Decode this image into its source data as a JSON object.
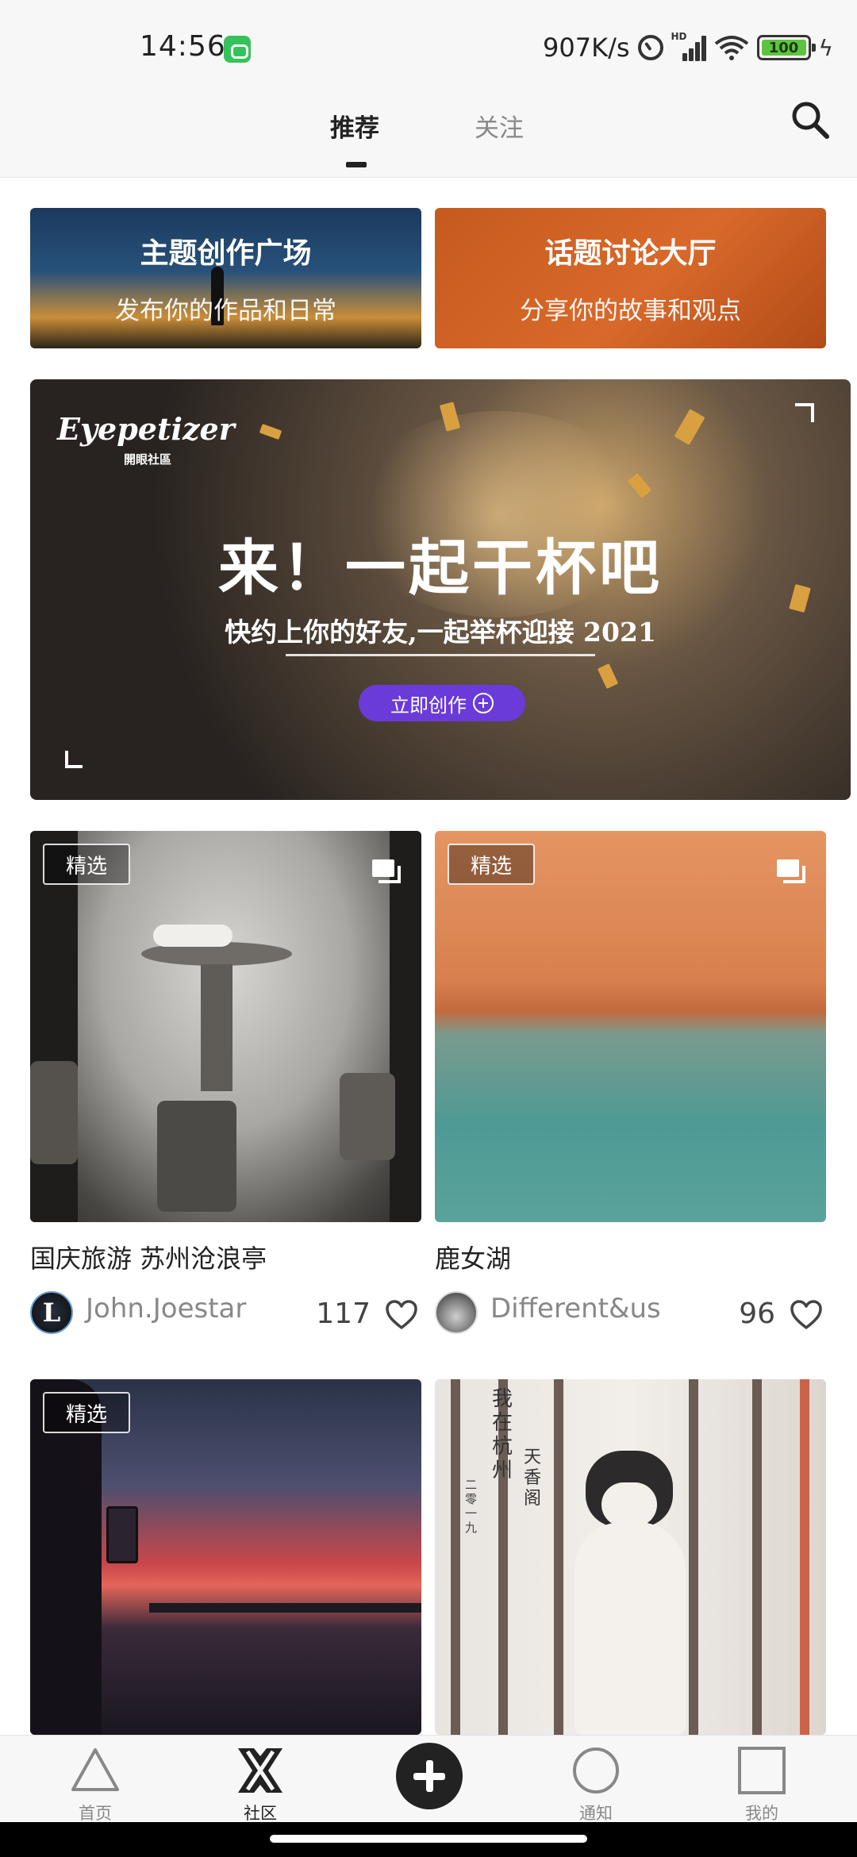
{
  "status_bar": {
    "time": "14:56",
    "net_speed": "907K/s",
    "signal_label": "HD",
    "battery_level": "100",
    "icons": [
      "app-badge-icon",
      "alarm-icon",
      "signal-icon",
      "wifi-icon",
      "battery-icon",
      "charging-icon"
    ]
  },
  "header": {
    "tabs": [
      {
        "label": "推荐",
        "active": true
      },
      {
        "label": "关注",
        "active": false
      }
    ],
    "search_icon": "search-icon"
  },
  "entry_cards": [
    {
      "title": "主题创作广场",
      "subtitle": "发布你的作品和日常"
    },
    {
      "title": "话题讨论大厅",
      "subtitle": "分享你的故事和观点"
    }
  ],
  "banner": {
    "logo": "Eyepetizer",
    "logo_sub": "開眼社區",
    "title": "来！一起干杯吧",
    "subtitle": "快约上你的好友,一起举杯迎接 2021",
    "cta": "立即创作"
  },
  "posts": [
    {
      "tag": "精选",
      "title": "国庆旅游 苏州沧浪亭",
      "author": "John.Joestar",
      "avatar_letter": "L",
      "likes": "117",
      "multi_image": true
    },
    {
      "tag": "精选",
      "title": "鹿女湖",
      "author": "Different&us",
      "likes": "96",
      "multi_image": true
    },
    {
      "tag": "精选",
      "title": "",
      "author": "",
      "likes": "",
      "multi_image": false
    },
    {
      "tag": "",
      "title": "",
      "author": "",
      "likes": "",
      "multi_image": false,
      "image_text": [
        "我在杭州",
        "天香阁",
        "二零一九"
      ]
    }
  ],
  "bottom_nav": {
    "items": [
      {
        "label": "首页",
        "icon": "triangle-icon"
      },
      {
        "label": "社区",
        "icon": "community-icon",
        "active": true
      },
      {
        "label": "",
        "icon": "plus-icon"
      },
      {
        "label": "通知",
        "icon": "circle-icon"
      },
      {
        "label": "我的",
        "icon": "square-icon"
      }
    ]
  },
  "colors": {
    "background": "#ffffff",
    "header_bg": "#f7f7f7",
    "text_primary": "#222222",
    "text_secondary": "#888888",
    "topic_card": "#c65a1e",
    "banner_cta": "#6a3bd8"
  }
}
